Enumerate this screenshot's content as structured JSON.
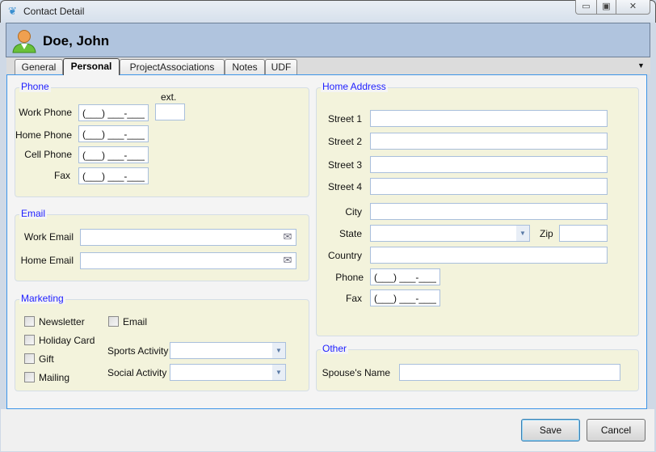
{
  "window": {
    "title": "Contact Detail",
    "icon": "bird-icon",
    "minimize": "minimize-icon",
    "maximize": "maximize-icon",
    "close": "close-icon"
  },
  "header": {
    "name": "Doe, John",
    "avatar_icon": "user-icon"
  },
  "tabs": [
    {
      "label": "General"
    },
    {
      "label": "Personal",
      "active": true
    },
    {
      "label": "ProjectAssociations"
    },
    {
      "label": "Notes"
    },
    {
      "label": "UDF"
    }
  ],
  "phone": {
    "legend": "Phone",
    "ext_label": "ext.",
    "work_label": "Work Phone",
    "home_label": "Home Phone",
    "cell_label": "Cell Phone",
    "fax_label": "Fax",
    "mask": "(___) ___-____",
    "ext_value": ""
  },
  "email": {
    "legend": "Email",
    "work_label": "Work Email",
    "home_label": "Home Email",
    "work_value": "",
    "home_value": ""
  },
  "marketing": {
    "legend": "Marketing",
    "checkboxes": [
      {
        "label": "Newsletter",
        "checked": false
      },
      {
        "label": "Holiday Card",
        "checked": false
      },
      {
        "label": "Gift",
        "checked": false
      },
      {
        "label": "Mailing",
        "checked": false
      },
      {
        "label": "Email",
        "checked": false
      }
    ],
    "sports_label": "Sports Activity",
    "sports_value": "",
    "social_label": "Social Activity",
    "social_value": ""
  },
  "address": {
    "legend": "Home Address",
    "street1_label": "Street 1",
    "street2_label": "Street 2",
    "street3_label": "Street 3",
    "street4_label": "Street 4",
    "city_label": "City",
    "state_label": "State",
    "zip_label": "Zip",
    "country_label": "Country",
    "phone_label": "Phone",
    "fax_label": "Fax",
    "mask": "(___) ___-____"
  },
  "other": {
    "legend": "Other",
    "spouse_label": "Spouse's Name",
    "spouse_value": ""
  },
  "buttons": {
    "save": "Save",
    "cancel": "Cancel"
  },
  "colors": {
    "header_bg": "#b0c4de",
    "group_bg": "#f3f3dc",
    "legend": "#1e1eff",
    "panel_border": "#3d95e8"
  }
}
